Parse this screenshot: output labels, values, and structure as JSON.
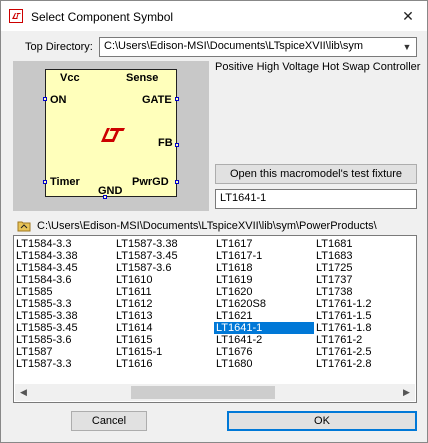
{
  "window": {
    "title": "Select Component Symbol",
    "close_glyph": "✕",
    "icon": "ltspice-app-icon"
  },
  "top_directory": {
    "label": "Top Directory:",
    "value": "C:\\Users\\Edison-MSI\\Documents\\LTspiceXVII\\lib\\sym"
  },
  "symbol": {
    "pins": {
      "vcc": "Vcc",
      "sense": "Sense",
      "on": "ON",
      "gate": "GATE",
      "fb": "FB",
      "timer": "Timer",
      "pwrgd": "PwrGD",
      "gnd": "GND"
    },
    "body_color": "#ffffbb",
    "logo_color": "#cc0000"
  },
  "description": "Positive High Voltage Hot Swap Controller",
  "fixture_button": "Open this macromodel's test fixture",
  "selected_name": "LT1641-1",
  "current_path": "C:\\Users\\Edison-MSI\\Documents\\LTspiceXVII\\lib\\sym\\PowerProducts\\",
  "list": {
    "columns": [
      [
        "LT1584-3.3",
        "LT1584-3.38",
        "LT1584-3.45",
        "LT1584-3.6",
        "LT1585",
        "LT1585-3.3",
        "LT1585-3.38",
        "LT1585-3.45",
        "LT1585-3.6",
        "LT1587",
        "LT1587-3.3"
      ],
      [
        "LT1587-3.38",
        "LT1587-3.45",
        "LT1587-3.6",
        "LT1610",
        "LT1611",
        "LT1612",
        "LT1613",
        "LT1614",
        "LT1615",
        "LT1615-1",
        "LT1616"
      ],
      [
        "LT1617",
        "LT1617-1",
        "LT1618",
        "LT1619",
        "LT1620",
        "LT1620S8",
        "LT1621",
        "LT1641-1",
        "LT1641-2",
        "LT1676",
        "LT1680"
      ],
      [
        "LT1681",
        "LT1683",
        "LT1725",
        "LT1737",
        "LT1738",
        "LT1761-1.2",
        "LT1761-1.5",
        "LT1761-1.8",
        "LT1761-2",
        "LT1761-2.5",
        "LT1761-2.8"
      ]
    ],
    "selected": "LT1641-1",
    "selection_color": "#0078d7"
  },
  "buttons": {
    "cancel": "Cancel",
    "ok": "OK"
  }
}
